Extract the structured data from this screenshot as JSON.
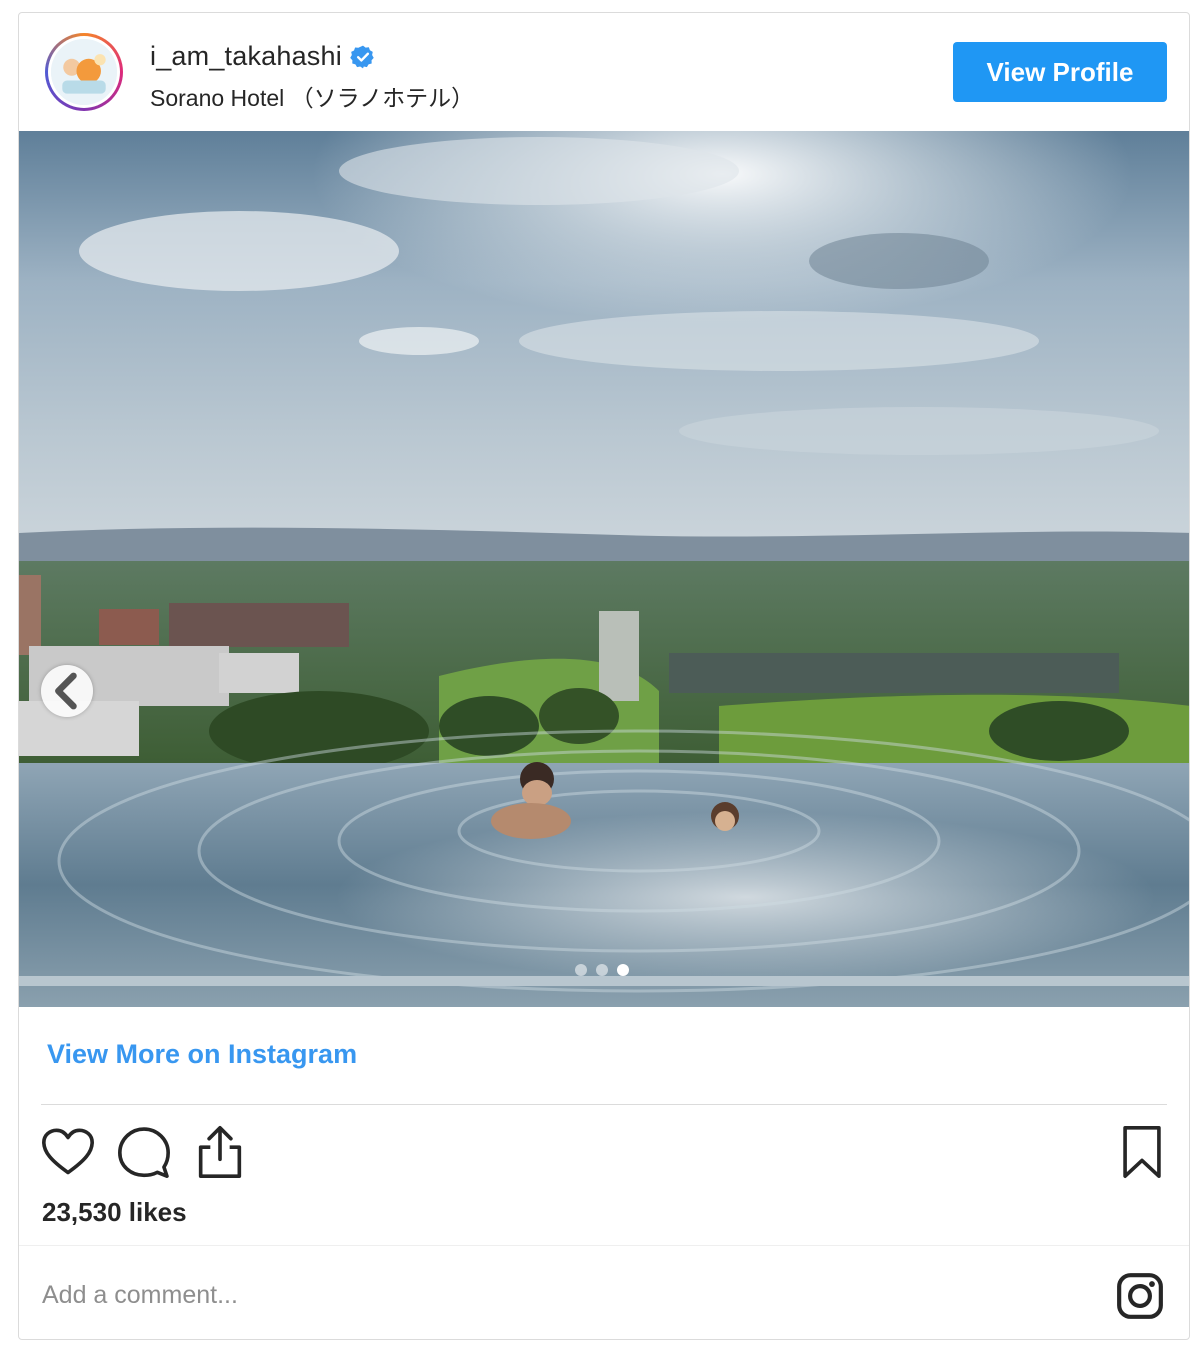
{
  "header": {
    "username": "i_am_takahashi",
    "verified": true,
    "location": "Sorano Hotel （ソラノホテル）",
    "view_profile_label": "View Profile"
  },
  "post": {
    "carousel": {
      "total_slides": 3,
      "active_slide": 3
    },
    "view_more_label": "View More on Instagram",
    "likes_text": "23,530 likes"
  },
  "comment": {
    "placeholder": "Add a comment..."
  },
  "icons": {
    "like": "heart-icon",
    "comment": "comment-icon",
    "share": "share-icon",
    "save": "bookmark-icon",
    "prev": "chevron-left-icon",
    "brand": "instagram-icon",
    "verified": "verified-badge-icon"
  },
  "colors": {
    "accent": "#1f97f4",
    "link": "#3897f0",
    "verified": "#3897f0",
    "text": "#262626",
    "muted": "#8e8e8e",
    "border": "#dbdbdb"
  }
}
